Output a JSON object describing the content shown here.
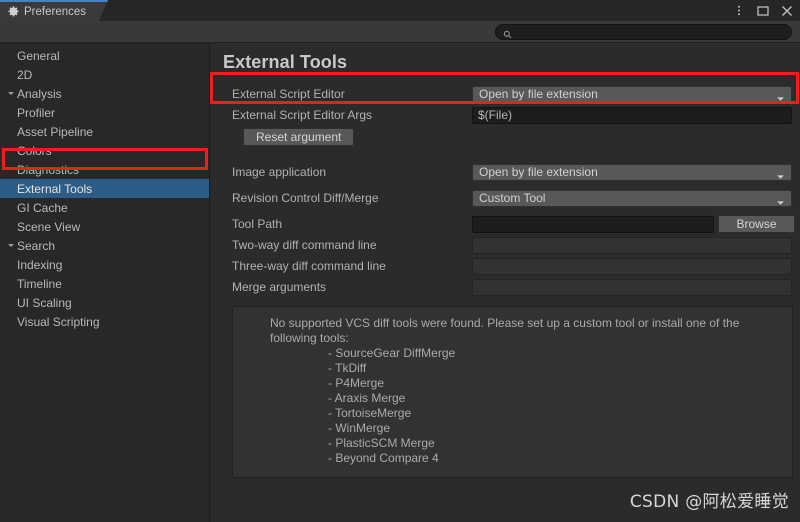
{
  "window": {
    "tab_label": "Preferences",
    "tab_icon": "gear-icon",
    "controls": {
      "menu": "kebab-menu-icon",
      "maximize": "maximize-icon",
      "close": "close-icon"
    }
  },
  "search": {
    "icon": "search-icon",
    "value": "",
    "placeholder": ""
  },
  "sidebar": {
    "items": [
      {
        "label": "General",
        "indent": 0,
        "arrow": "none",
        "selected": false
      },
      {
        "label": "2D",
        "indent": 0,
        "arrow": "none",
        "selected": false
      },
      {
        "label": "Analysis",
        "indent": 0,
        "arrow": "down",
        "selected": false
      },
      {
        "label": "Profiler",
        "indent": 1,
        "arrow": "none",
        "selected": false
      },
      {
        "label": "Asset Pipeline",
        "indent": 0,
        "arrow": "none",
        "selected": false
      },
      {
        "label": "Colors",
        "indent": 0,
        "arrow": "none",
        "selected": false
      },
      {
        "label": "Diagnostics",
        "indent": 0,
        "arrow": "none",
        "selected": false
      },
      {
        "label": "External Tools",
        "indent": 0,
        "arrow": "none",
        "selected": true
      },
      {
        "label": "GI Cache",
        "indent": 0,
        "arrow": "none",
        "selected": false
      },
      {
        "label": "Scene View",
        "indent": 0,
        "arrow": "none",
        "selected": false
      },
      {
        "label": "Search",
        "indent": 0,
        "arrow": "down",
        "selected": false
      },
      {
        "label": "Indexing",
        "indent": 1,
        "arrow": "none",
        "selected": false
      },
      {
        "label": "Timeline",
        "indent": 0,
        "arrow": "none",
        "selected": false
      },
      {
        "label": "UI Scaling",
        "indent": 0,
        "arrow": "none",
        "selected": false
      },
      {
        "label": "Visual Scripting",
        "indent": 0,
        "arrow": "none",
        "selected": false
      }
    ]
  },
  "main": {
    "title": "External Tools",
    "fields": {
      "external_script_editor": {
        "label": "External Script Editor",
        "value": "Open by file extension"
      },
      "external_script_editor_args": {
        "label": "External Script Editor Args",
        "value": "$(File)"
      },
      "reset_argument": {
        "label": "Reset argument"
      },
      "image_application": {
        "label": "Image application",
        "value": "Open by file extension"
      },
      "revision_control": {
        "label": "Revision Control Diff/Merge",
        "value": "Custom Tool"
      },
      "tool_path": {
        "label": "Tool Path",
        "value": "",
        "browse_label": "Browse"
      },
      "two_way_diff": {
        "label": "Two-way diff command line",
        "value": ""
      },
      "three_way_diff": {
        "label": "Three-way diff command line",
        "value": ""
      },
      "merge_arguments": {
        "label": "Merge arguments",
        "value": ""
      }
    },
    "helpbox": {
      "message": "No supported VCS diff tools were found. Please set up a custom tool or install one of the following tools:",
      "tools": [
        "- SourceGear DiffMerge",
        "- TkDiff",
        "- P4Merge",
        "- Araxis Merge",
        "- TortoiseMerge",
        "- WinMerge",
        "- PlasticSCM Merge",
        "- Beyond Compare 4"
      ]
    }
  },
  "annotations": {
    "highlight_color": "#f01d1d",
    "boxes": [
      "sidebar-external-tools",
      "external-script-editor-row"
    ]
  },
  "watermark": {
    "text": "CSDN @阿松爱睡觉"
  },
  "colors": {
    "background": "#282828",
    "panel": "#2b2b2b",
    "selection": "#2c5d87",
    "tab_accent": "#4a80c8",
    "text": "#b4b4b4"
  }
}
